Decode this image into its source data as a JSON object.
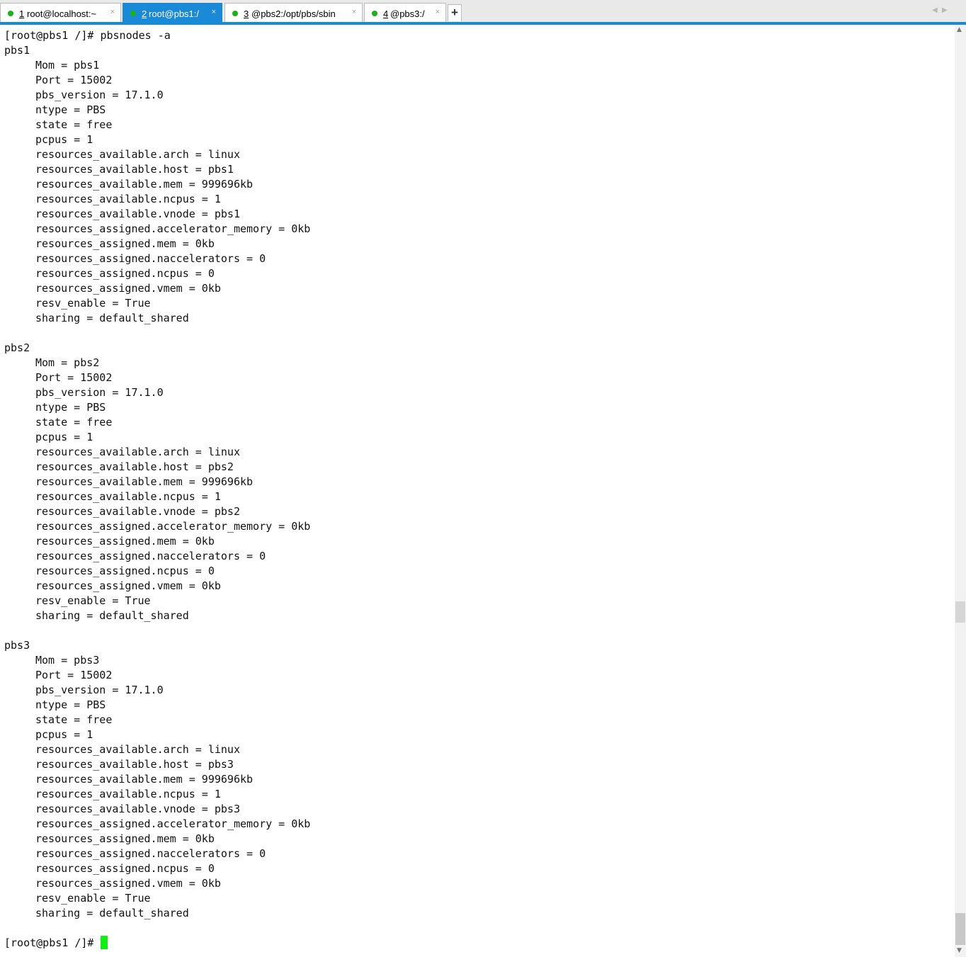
{
  "tabs": [
    {
      "number": "1",
      "title": "root@localhost:~",
      "active": false
    },
    {
      "number": "2",
      "title": "root@pbs1:/",
      "active": true
    },
    {
      "number": "3",
      "title": "@pbs2:/opt/pbs/sbin",
      "active": false
    },
    {
      "number": "4",
      "title": "@pbs3:/",
      "active": false
    }
  ],
  "tab_close_glyph": "×",
  "new_tab_label": "+",
  "colors": {
    "accent": "#1a8ad6",
    "session_dot": "#17b317",
    "cursor": "#11ee11",
    "terminal_bg": "#ffffff",
    "terminal_fg": "#111111"
  },
  "terminal": {
    "prompt": "[root@pbs1 /]# ",
    "command": "pbsnodes -a",
    "nodes": [
      {
        "name": "pbs1",
        "attributes": [
          "Mom = pbs1",
          "Port = 15002",
          "pbs_version = 17.1.0",
          "ntype = PBS",
          "state = free",
          "pcpus = 1",
          "resources_available.arch = linux",
          "resources_available.host = pbs1",
          "resources_available.mem = 999696kb",
          "resources_available.ncpus = 1",
          "resources_available.vnode = pbs1",
          "resources_assigned.accelerator_memory = 0kb",
          "resources_assigned.mem = 0kb",
          "resources_assigned.naccelerators = 0",
          "resources_assigned.ncpus = 0",
          "resources_assigned.vmem = 0kb",
          "resv_enable = True",
          "sharing = default_shared"
        ]
      },
      {
        "name": "pbs2",
        "attributes": [
          "Mom = pbs2",
          "Port = 15002",
          "pbs_version = 17.1.0",
          "ntype = PBS",
          "state = free",
          "pcpus = 1",
          "resources_available.arch = linux",
          "resources_available.host = pbs2",
          "resources_available.mem = 999696kb",
          "resources_available.ncpus = 1",
          "resources_available.vnode = pbs2",
          "resources_assigned.accelerator_memory = 0kb",
          "resources_assigned.mem = 0kb",
          "resources_assigned.naccelerators = 0",
          "resources_assigned.ncpus = 0",
          "resources_assigned.vmem = 0kb",
          "resv_enable = True",
          "sharing = default_shared"
        ]
      },
      {
        "name": "pbs3",
        "attributes": [
          "Mom = pbs3",
          "Port = 15002",
          "pbs_version = 17.1.0",
          "ntype = PBS",
          "state = free",
          "pcpus = 1",
          "resources_available.arch = linux",
          "resources_available.host = pbs3",
          "resources_available.mem = 999696kb",
          "resources_available.ncpus = 1",
          "resources_available.vnode = pbs3",
          "resources_assigned.accelerator_memory = 0kb",
          "resources_assigned.mem = 0kb",
          "resources_assigned.naccelerators = 0",
          "resources_assigned.ncpus = 0",
          "resources_assigned.vmem = 0kb",
          "resv_enable = True",
          "sharing = default_shared"
        ]
      }
    ]
  }
}
